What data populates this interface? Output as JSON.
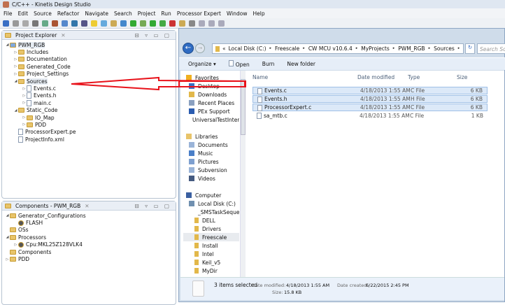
{
  "window": {
    "title": "C/C++ - Kinetis Design Studio"
  },
  "menu": [
    "File",
    "Edit",
    "Source",
    "Refactor",
    "Navigate",
    "Search",
    "Project",
    "Run",
    "Processor Expert",
    "Window",
    "Help"
  ],
  "project_explorer": {
    "title": "Project Explorer",
    "items": [
      {
        "label": "PWM_RGB",
        "indent": 0,
        "type": "project",
        "tw": "◢"
      },
      {
        "label": "Includes",
        "indent": 1,
        "type": "folder",
        "tw": "▷"
      },
      {
        "label": "Documentation",
        "indent": 1,
        "type": "folder",
        "tw": "▷"
      },
      {
        "label": "Generated_Code",
        "indent": 1,
        "type": "folder",
        "tw": "▷"
      },
      {
        "label": "Project_Settings",
        "indent": 1,
        "type": "folder",
        "tw": "▷"
      },
      {
        "label": "Sources",
        "indent": 1,
        "type": "folder",
        "tw": "◢"
      },
      {
        "label": "Events.c",
        "indent": 2,
        "type": "file",
        "tw": "▷"
      },
      {
        "label": "Events.h",
        "indent": 2,
        "type": "file",
        "tw": "▷"
      },
      {
        "label": "main.c",
        "indent": 2,
        "type": "file",
        "tw": "▷"
      },
      {
        "label": "Static_Code",
        "indent": 1,
        "type": "folder",
        "tw": "◢"
      },
      {
        "label": "IO_Map",
        "indent": 2,
        "type": "folder",
        "tw": "▷"
      },
      {
        "label": "PDD",
        "indent": 2,
        "type": "folder",
        "tw": "▷"
      },
      {
        "label": "ProcessorExpert.pe",
        "indent": 1,
        "type": "file",
        "tw": ""
      },
      {
        "label": "ProjectInfo.xml",
        "indent": 1,
        "type": "file",
        "tw": ""
      }
    ]
  },
  "components": {
    "title": "Components - PWM_RGB",
    "items": [
      {
        "label": "Generator_Configurations",
        "indent": 0,
        "type": "folder",
        "tw": "◢"
      },
      {
        "label": "FLASH",
        "indent": 1,
        "type": "gear",
        "tw": ""
      },
      {
        "label": "OSs",
        "indent": 0,
        "type": "folder",
        "tw": ""
      },
      {
        "label": "Processors",
        "indent": 0,
        "type": "folder",
        "tw": "◢"
      },
      {
        "label": "Cpu:MKL25Z128VLK4",
        "indent": 1,
        "type": "cpu",
        "tw": "▷"
      },
      {
        "label": "Components",
        "indent": 0,
        "type": "folder",
        "tw": ""
      },
      {
        "label": "PDD",
        "indent": 0,
        "type": "folder",
        "tw": "▷"
      }
    ]
  },
  "explorer": {
    "breadcrumb": [
      "Local Disk (C:)",
      "Freescale",
      "CW MCU v10.6.4",
      "MyProjects",
      "PWM_RGB",
      "Sources"
    ],
    "search_placeholder": "Search Sources",
    "toolbar": {
      "organize": "Organize ▾",
      "open": "Open",
      "burn": "Burn",
      "new_folder": "New folder"
    },
    "nav": [
      {
        "label": "Favorites",
        "level": 0,
        "c": "#f0b020"
      },
      {
        "label": "Desktop",
        "level": 1,
        "c": "#3a6fc4"
      },
      {
        "label": "Downloads",
        "level": 1,
        "c": "#e2b84a"
      },
      {
        "label": "Recent Places",
        "level": 1,
        "c": "#8aa0c0"
      },
      {
        "label": "PEx Support",
        "level": 1,
        "c": "#2a5cb0"
      },
      {
        "label": "UniversalTestInter",
        "level": 1,
        "c": "#e2b84a"
      },
      {
        "label": "",
        "level": 0,
        "c": ""
      },
      {
        "label": "Libraries",
        "level": 0,
        "c": "#e8c46a"
      },
      {
        "label": "Documents",
        "level": 1,
        "c": "#9ab4d8"
      },
      {
        "label": "Music",
        "level": 1,
        "c": "#4a7fc8"
      },
      {
        "label": "Pictures",
        "level": 1,
        "c": "#7ea0d0"
      },
      {
        "label": "Subversion",
        "level": 1,
        "c": "#9ab4d8"
      },
      {
        "label": "Videos",
        "level": 1,
        "c": "#445a80"
      },
      {
        "label": "",
        "level": 0,
        "c": ""
      },
      {
        "label": "Computer",
        "level": 0,
        "c": "#3a5fa0"
      },
      {
        "label": "Local Disk (C:)",
        "level": 1,
        "c": "#7090b0"
      },
      {
        "label": "_SMSTaskSeque",
        "level": 2,
        "c": "#e2b84a"
      },
      {
        "label": "DELL",
        "level": 2,
        "c": "#e2b84a"
      },
      {
        "label": "Drivers",
        "level": 2,
        "c": "#e2b84a"
      },
      {
        "label": "Freescale",
        "level": 2,
        "c": "#e2b84a"
      },
      {
        "label": "Install",
        "level": 2,
        "c": "#e2b84a"
      },
      {
        "label": "Intel",
        "level": 2,
        "c": "#e2b84a"
      },
      {
        "label": "Keil_v5",
        "level": 2,
        "c": "#e2b84a"
      },
      {
        "label": "MyDir",
        "level": 2,
        "c": "#e2b84a"
      }
    ],
    "columns": [
      "Name",
      "Date modified",
      "Type",
      "Size"
    ],
    "files": [
      {
        "name": "Events.c",
        "date": "4/18/2013 1:55 AM",
        "type": "C File",
        "size": "6 KB",
        "selected": true
      },
      {
        "name": "Events.h",
        "date": "4/18/2013 1:55 AM",
        "type": "H File",
        "size": "6 KB",
        "selected": true
      },
      {
        "name": "ProcessorExpert.c",
        "date": "4/18/2013 1:55 AM",
        "type": "C File",
        "size": "6 KB",
        "selected": true
      },
      {
        "name": "sa_mtb.c",
        "date": "4/18/2013 1:55 AM",
        "type": "C File",
        "size": "1 KB",
        "selected": false
      }
    ],
    "status": {
      "count": "3 items selected",
      "modified_label": "Date modified:",
      "modified": "4/18/2013 1:55 AM",
      "created_label": "Date created:",
      "created": "6/22/2015 2:45 PM",
      "size_label": "Size:",
      "size": "15.8 KB"
    }
  },
  "colors": {
    "annotation_arrow": "#e8131b",
    "selection": "#dce9f8"
  }
}
